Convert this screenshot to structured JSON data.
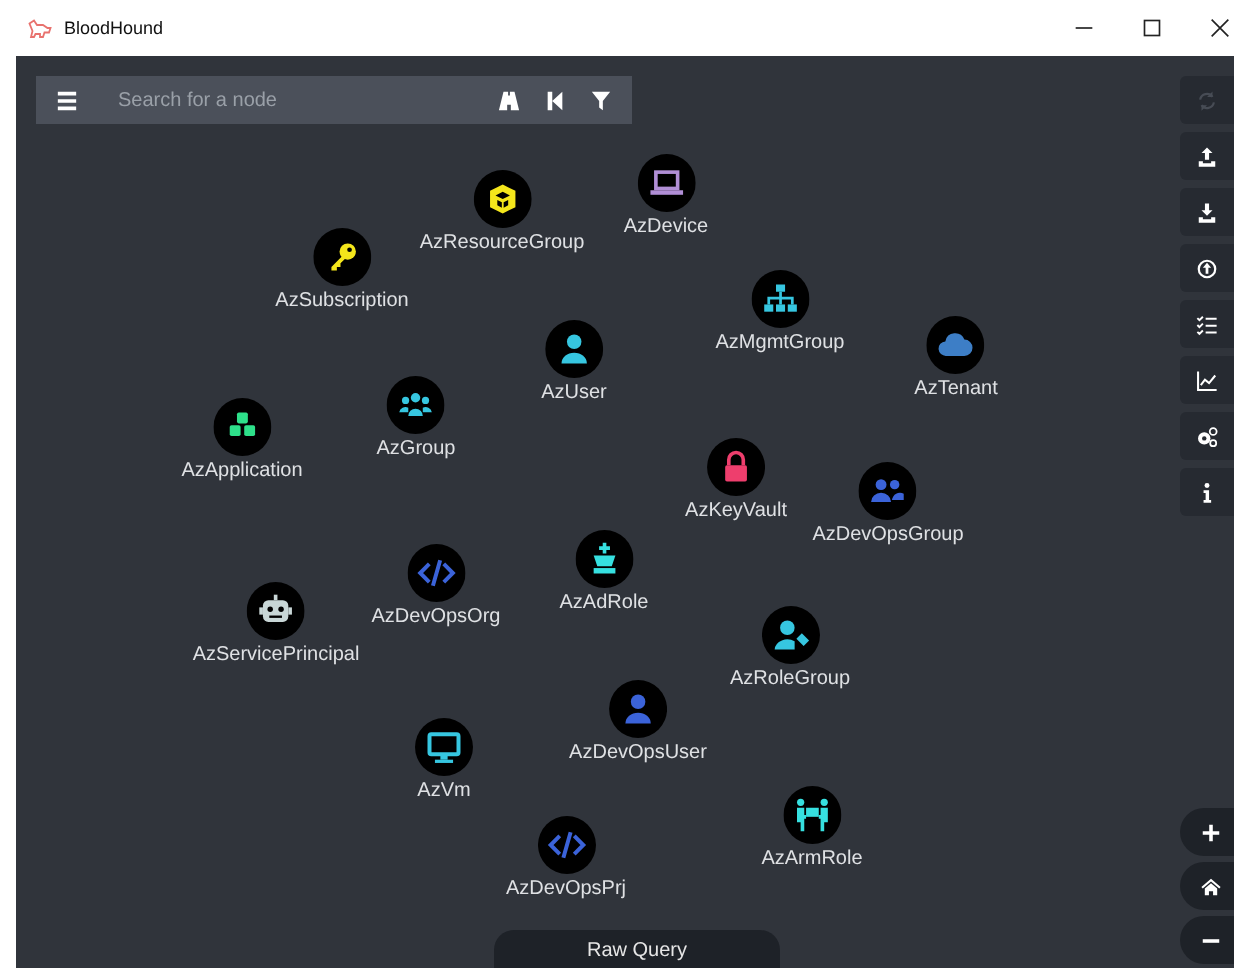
{
  "window": {
    "title": "BloodHound"
  },
  "search": {
    "placeholder": "Search for a node"
  },
  "side_buttons": [
    {
      "kind": "refresh",
      "disabled": true
    },
    {
      "kind": "upload",
      "disabled": false
    },
    {
      "kind": "download",
      "disabled": false
    },
    {
      "kind": "circle-up",
      "disabled": false
    },
    {
      "kind": "checklist",
      "disabled": false
    },
    {
      "kind": "chart",
      "disabled": false
    },
    {
      "kind": "gears",
      "disabled": false
    },
    {
      "kind": "info",
      "disabled": false
    }
  ],
  "zoom_buttons": [
    {
      "kind": "plus"
    },
    {
      "kind": "home"
    },
    {
      "kind": "minus"
    }
  ],
  "nodes": [
    {
      "label": "AzResourceGroup",
      "kind": "cube",
      "color": "#f4e61b"
    },
    {
      "label": "AzDevice",
      "kind": "laptop",
      "color": "#b18fd6"
    },
    {
      "label": "AzSubscription",
      "kind": "key",
      "color": "#f4e61b"
    },
    {
      "label": "AzMgmtGroup",
      "kind": "hierarchy",
      "color": "#36c6e0"
    },
    {
      "label": "AzTenant",
      "kind": "cloud",
      "color": "#3d7ec6"
    },
    {
      "label": "AzUser",
      "kind": "user",
      "color": "#36c6e0"
    },
    {
      "label": "AzGroup",
      "kind": "group",
      "color": "#36c6e0"
    },
    {
      "label": "AzApplication",
      "kind": "cubes",
      "color": "#2ee08a"
    },
    {
      "label": "AzKeyVault",
      "kind": "lock",
      "color": "#ee3e6d"
    },
    {
      "label": "AzDevOpsGroup",
      "kind": "pair",
      "color": "#3b63d9"
    },
    {
      "label": "AzAdRole",
      "kind": "king",
      "color": "#36e0e0"
    },
    {
      "label": "AzDevOpsOrg",
      "kind": "code",
      "color": "#3b63d9"
    },
    {
      "label": "AzServicePrincipal",
      "kind": "robot",
      "color": "#c8d6d6"
    },
    {
      "label": "AzRoleGroup",
      "kind": "user-tag",
      "color": "#36c6e0"
    },
    {
      "label": "AzDevOpsUser",
      "kind": "user",
      "color": "#3b63d9"
    },
    {
      "label": "AzVm",
      "kind": "monitor",
      "color": "#36c6e0"
    },
    {
      "label": "AzArmRole",
      "kind": "carry",
      "color": "#36e0e0"
    },
    {
      "label": "AzDevOpsPrj",
      "kind": "code",
      "color": "#3b63d9"
    }
  ],
  "raw_query": {
    "label": "Raw Query"
  }
}
